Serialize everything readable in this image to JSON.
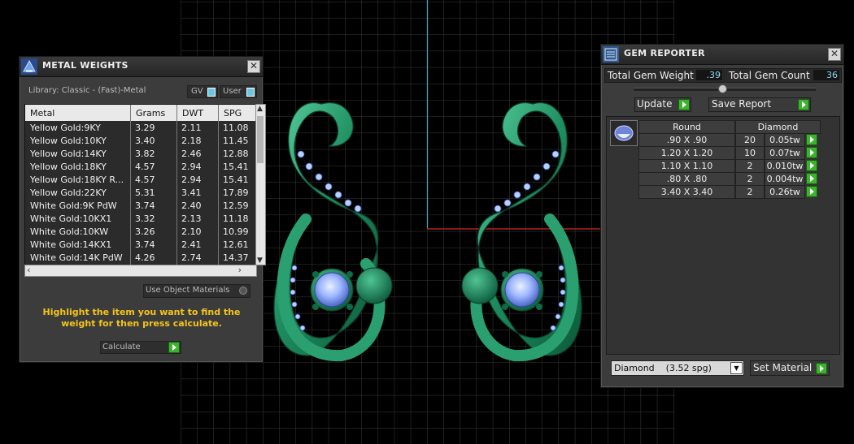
{
  "metal_weights": {
    "title": "METAL WEIGHTS",
    "library": "Library: Classic - (Fast)-Metal",
    "gv_label": "GV",
    "user_label": "User",
    "columns": [
      "Metal",
      "Grams",
      "DWT",
      "SPG"
    ],
    "rows": [
      {
        "metal": "Yellow Gold:9KY",
        "grams": "3.29",
        "dwt": "2.11",
        "spg": "11.08"
      },
      {
        "metal": "Yellow Gold:10KY",
        "grams": "3.40",
        "dwt": "2.18",
        "spg": "11.45"
      },
      {
        "metal": "Yellow Gold:14KY",
        "grams": "3.82",
        "dwt": "2.46",
        "spg": "12.88"
      },
      {
        "metal": "Yellow Gold:18KY",
        "grams": "4.57",
        "dwt": "2.94",
        "spg": "15.41"
      },
      {
        "metal": "Yellow Gold:18KY R...",
        "grams": "4.57",
        "dwt": "2.94",
        "spg": "15.41"
      },
      {
        "metal": "Yellow Gold:22KY",
        "grams": "5.31",
        "dwt": "3.41",
        "spg": "17.89"
      },
      {
        "metal": "White Gold:9K PdW",
        "grams": "3.74",
        "dwt": "2.40",
        "spg": "12.59"
      },
      {
        "metal": "White Gold:10KX1",
        "grams": "3.32",
        "dwt": "2.13",
        "spg": "11.18"
      },
      {
        "metal": "White Gold:10KW",
        "grams": "3.26",
        "dwt": "2.10",
        "spg": "10.99"
      },
      {
        "metal": "White Gold:14KX1",
        "grams": "3.74",
        "dwt": "2.41",
        "spg": "12.61"
      },
      {
        "metal": "White Gold:14K PdW",
        "grams": "4.26",
        "dwt": "2.74",
        "spg": "14.37"
      }
    ],
    "use_object_materials": "Use Object Materials",
    "instructions": "Highlight the item you want to find the weight for then press calculate.",
    "calculate_label": "Calculate"
  },
  "gem_reporter": {
    "title": "GEM REPORTER",
    "total_weight_label": "Total Gem Weight",
    "total_weight_value": ".39",
    "total_count_label": "Total Gem Count",
    "total_count_value": "36",
    "update_label": "Update",
    "save_report_label": "Save Report",
    "col_shape": "Round",
    "col_material": "Diamond",
    "rows": [
      {
        "size": ".90 X .90",
        "count": "20",
        "weight": "0.05tw"
      },
      {
        "size": "1.20 X 1.20",
        "count": "10",
        "weight": "0.07tw"
      },
      {
        "size": "1.10 X 1.10",
        "count": "2",
        "weight": "0.010tw"
      },
      {
        "size": ".80 X .80",
        "count": "2",
        "weight": "0.004tw"
      },
      {
        "size": "3.40 X 3.40",
        "count": "2",
        "weight": "0.26tw"
      }
    ],
    "material_select": "Diamond    (3.52 spg)",
    "set_material_label": "Set Material"
  },
  "colors": {
    "accent_yellow": "#f3c51a",
    "value_cyan": "#8fd8f0",
    "button_green": "#3cb32e",
    "metal_green": "#1d8a5f",
    "gem_blue": "#9fb8ff"
  }
}
